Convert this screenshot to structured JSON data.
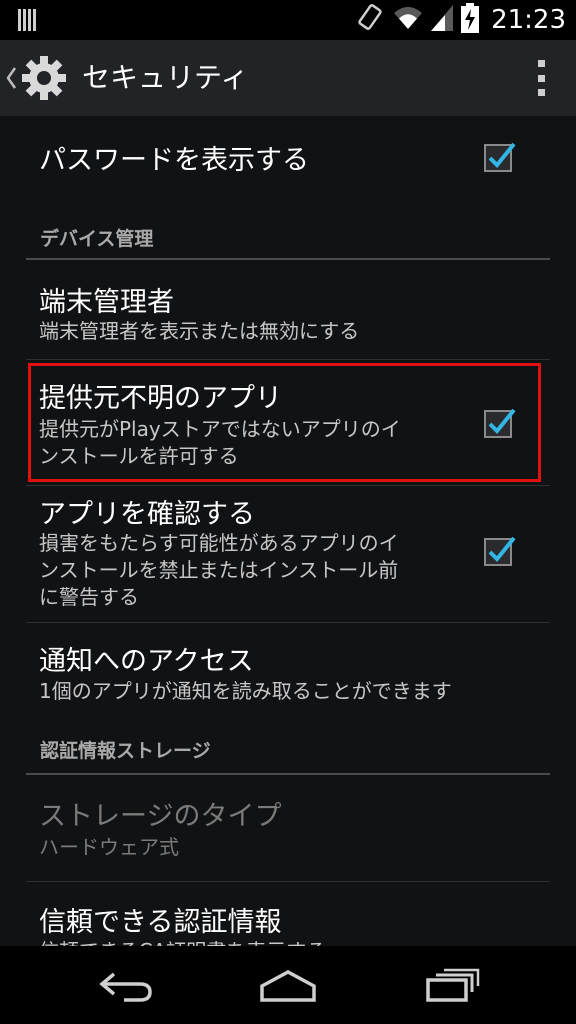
{
  "status_bar": {
    "time": "21:23",
    "icons": [
      "notification-icon",
      "rotate-icon",
      "wifi-icon",
      "signal-icon",
      "battery-charging-icon"
    ]
  },
  "action_bar": {
    "title": "セキュリティ",
    "icons": [
      "back-chevron-icon",
      "settings-gear-icon",
      "overflow-menu-icon"
    ]
  },
  "settings": {
    "show_password": {
      "title": "パスワードを表示する",
      "checked": true
    },
    "device_admin_header": "デバイス管理",
    "device_admins": {
      "title": "端末管理者",
      "summary": "端末管理者を表示または無効にする"
    },
    "unknown_sources": {
      "title": "提供元不明のアプリ",
      "summary_line1": "提供元がPlayストアではないアプリのイ",
      "summary_line2": "ンストールを許可する",
      "checked": true
    },
    "verify_apps": {
      "title": "アプリを確認する",
      "summary_line1": "損害をもたらす可能性があるアプリのイ",
      "summary_line2": "ンストールを禁止またはインストール前",
      "summary_line3": "に警告する",
      "checked": true
    },
    "notification_access": {
      "title": "通知へのアクセス",
      "summary": "1個のアプリが通知を読み取ることができます"
    },
    "credential_storage_header": "認証情報ストレージ",
    "storage_type": {
      "title": "ストレージのタイプ",
      "summary": "ハードウェア式"
    },
    "trusted_credentials": {
      "title": "信頼できる認証情報",
      "summary": "信頼できるCA証明書を表示する"
    }
  },
  "nav_bar": {
    "icons": [
      "back-icon",
      "home-icon",
      "recent-apps-icon"
    ]
  },
  "colors": {
    "accent": "#33b5e5",
    "highlight": "#e01010",
    "action_bar": "#222326",
    "background": "#111214"
  }
}
